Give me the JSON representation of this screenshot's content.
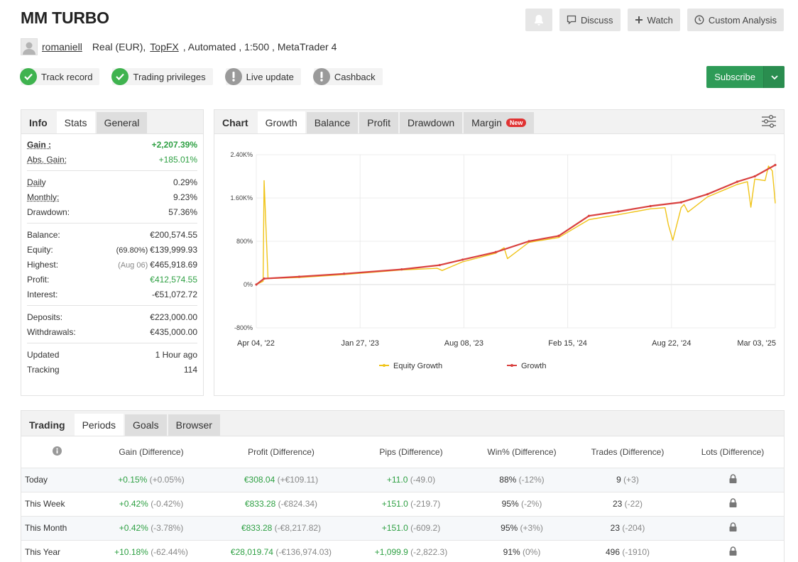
{
  "header": {
    "title": "MM TURBO",
    "actions": {
      "discuss": "Discuss",
      "watch": "Watch",
      "custom": "Custom Analysis"
    }
  },
  "meta": {
    "user": "romaniell",
    "account_type": "Real (EUR),",
    "broker": "TopFX",
    "rest": ", Automated , 1:500 , MetaTrader 4"
  },
  "badges": [
    {
      "label": "Track record",
      "status": "ok"
    },
    {
      "label": "Trading privileges",
      "status": "ok"
    },
    {
      "label": "Live update",
      "status": "warn"
    },
    {
      "label": "Cashback",
      "status": "warn"
    }
  ],
  "subscribe_label": "Subscribe",
  "left_panel": {
    "tabs": [
      "Info",
      "Stats",
      "General"
    ],
    "rows": [
      {
        "k": "Gain :",
        "v": "+2,207.39%"
      },
      {
        "k": "Abs. Gain:",
        "v": "+185.01%"
      },
      {
        "k": "Daily",
        "v": "0.29%"
      },
      {
        "k": "Monthly:",
        "v": "9.23%"
      },
      {
        "k": "Drawdown:",
        "v": "57.36%"
      },
      {
        "k": "Balance:",
        "v": "€200,574.55"
      },
      {
        "k": "Equity:",
        "sub": "(69.80%)",
        "v": "€139,999.93"
      },
      {
        "k": "Highest:",
        "sub": "(Aug 06)",
        "v": "€465,918.69"
      },
      {
        "k": "Profit:",
        "v": "€412,574.55"
      },
      {
        "k": "Interest:",
        "v": "-€51,072.72"
      },
      {
        "k": "Deposits:",
        "v": "€223,000.00"
      },
      {
        "k": "Withdrawals:",
        "v": "€435,000.00"
      },
      {
        "k": "Updated",
        "v": "1 Hour ago"
      },
      {
        "k": "Tracking",
        "v": "114"
      }
    ]
  },
  "chart_panel": {
    "tabs": [
      "Chart",
      "Growth",
      "Balance",
      "Profit",
      "Drawdown",
      "Margin"
    ],
    "new_badge": "New"
  },
  "chart_data": {
    "type": "line",
    "ylim": [
      -800,
      2400
    ],
    "y_ticks": [
      "2.40K%",
      "1.60K%",
      "800%",
      "0%",
      "-800%"
    ],
    "y_tick_values": [
      2400,
      1600,
      800,
      0,
      -800
    ],
    "x_ticks": [
      "Apr 04, '22",
      "Jan 27, '23",
      "Aug 08, '23",
      "Feb 15, '24",
      "Aug 22, '24",
      "Mar 03, '25"
    ],
    "xlim": [
      "2022-04-04",
      "2025-03-03"
    ],
    "series": [
      {
        "name": "Growth",
        "color": "#d9413f",
        "x": [
          "2022-04-04",
          "2022-04-20",
          "2022-07-01",
          "2022-10-01",
          "2023-01-27",
          "2023-04-15",
          "2023-06-01",
          "2023-08-08",
          "2023-10-15",
          "2023-12-15",
          "2024-02-15",
          "2024-04-15",
          "2024-06-20",
          "2024-08-22",
          "2024-10-15",
          "2024-12-15",
          "2025-01-20",
          "2025-03-03"
        ],
        "values": [
          0,
          110,
          145,
          200,
          280,
          360,
          460,
          600,
          800,
          900,
          1270,
          1350,
          1450,
          1520,
          1670,
          1900,
          2000,
          2210
        ]
      },
      {
        "name": "Equity Growth",
        "color": "#f0c419",
        "x": [
          "2022-04-04",
          "2022-04-18",
          "2022-04-20",
          "2022-04-28",
          "2022-07-01",
          "2022-10-01",
          "2023-01-27",
          "2023-04-10",
          "2023-04-20",
          "2023-06-01",
          "2023-08-08",
          "2023-08-25",
          "2023-09-01",
          "2023-10-15",
          "2023-12-15",
          "2024-02-15",
          "2024-04-15",
          "2024-06-20",
          "2024-07-20",
          "2024-07-27",
          "2024-08-05",
          "2024-08-22",
          "2024-08-28",
          "2024-09-05",
          "2024-10-15",
          "2024-12-15",
          "2025-01-05",
          "2025-01-12",
          "2025-01-20",
          "2025-02-10",
          "2025-02-17",
          "2025-02-25",
          "2025-03-03"
        ],
        "values": [
          0,
          60,
          1920,
          110,
          130,
          185,
          270,
          300,
          260,
          420,
          580,
          680,
          480,
          780,
          870,
          1200,
          1290,
          1400,
          1420,
          1100,
          820,
          1420,
          1480,
          1340,
          1620,
          1850,
          1900,
          1430,
          1950,
          1920,
          2190,
          2100,
          1500
        ]
      }
    ]
  },
  "trading_panel": {
    "tabs": [
      "Trading",
      "Periods",
      "Goals",
      "Browser"
    ],
    "columns": [
      "Gain (Difference)",
      "Profit (Difference)",
      "Pips (Difference)",
      "Win% (Difference)",
      "Trades (Difference)",
      "Lots (Difference)"
    ],
    "rows": [
      {
        "period": "Today",
        "gain": "+0.15%",
        "gain_d": "(+0.05%)",
        "profit": "€308.04",
        "profit_d": "(+€109.11)",
        "pips": "+11.0",
        "pips_d": "(-49.0)",
        "win": "88%",
        "win_d": "(-12%)",
        "trades": "9",
        "trades_d": "(+3)"
      },
      {
        "period": "This Week",
        "gain": "+0.42%",
        "gain_d": "(-0.42%)",
        "profit": "€833.28",
        "profit_d": "(-€824.34)",
        "pips": "+151.0",
        "pips_d": "(-219.7)",
        "win": "95%",
        "win_d": "(-2%)",
        "trades": "23",
        "trades_d": "(-22)"
      },
      {
        "period": "This Month",
        "gain": "+0.42%",
        "gain_d": "(-3.78%)",
        "profit": "€833.28",
        "profit_d": "(-€8,217.82)",
        "pips": "+151.0",
        "pips_d": "(-609.2)",
        "win": "95%",
        "win_d": "(+3%)",
        "trades": "23",
        "trades_d": "(-204)"
      },
      {
        "period": "This Year",
        "gain": "+10.18%",
        "gain_d": "(-62.44%)",
        "profit": "€28,019.74",
        "profit_d": "(-€136,974.03)",
        "pips": "+1,099.9",
        "pips_d": "(-2,822.3)",
        "win": "91%",
        "win_d": "(0%)",
        "trades": "496",
        "trades_d": "(-1910)"
      }
    ]
  }
}
